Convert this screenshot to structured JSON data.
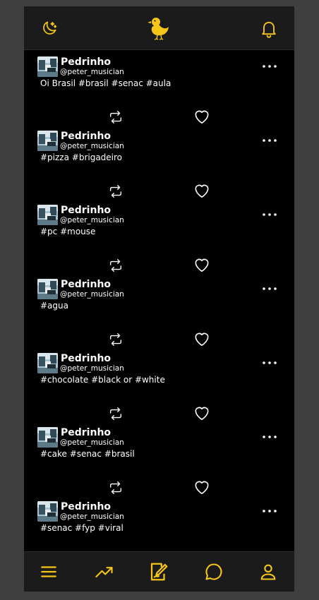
{
  "colors": {
    "accent": "#f5c518",
    "background": "#000000",
    "bar_background": "#1b1b1b",
    "text": "#ffffff",
    "page_background": "#3f3f3f"
  },
  "header": {
    "left_icon": "moon-icon",
    "center_icon": "duck-logo-icon",
    "right_icon": "bell-icon"
  },
  "posts": [
    {
      "name": "Pedrinho",
      "handle": "@peter_musician",
      "text": "Oi Brasil #brasil #senac #aula"
    },
    {
      "name": "Pedrinho",
      "handle": "@peter_musician",
      "text": "#pizza #brigadeiro"
    },
    {
      "name": "Pedrinho",
      "handle": "@peter_musician",
      "text": "#pc #mouse"
    },
    {
      "name": "Pedrinho",
      "handle": "@peter_musician",
      "text": "#agua"
    },
    {
      "name": "Pedrinho",
      "handle": "@peter_musician",
      "text": "#chocolate #black or #white"
    },
    {
      "name": "Pedrinho",
      "handle": "@peter_musician",
      "text": "#cake #senac #brasil"
    },
    {
      "name": "Pedrinho",
      "handle": "@peter_musician",
      "text": "#senac #fyp #viral"
    }
  ],
  "bottom_nav": [
    {
      "icon": "menu-icon"
    },
    {
      "icon": "trending-icon"
    },
    {
      "icon": "compose-icon"
    },
    {
      "icon": "chat-icon"
    },
    {
      "icon": "profile-icon"
    }
  ]
}
